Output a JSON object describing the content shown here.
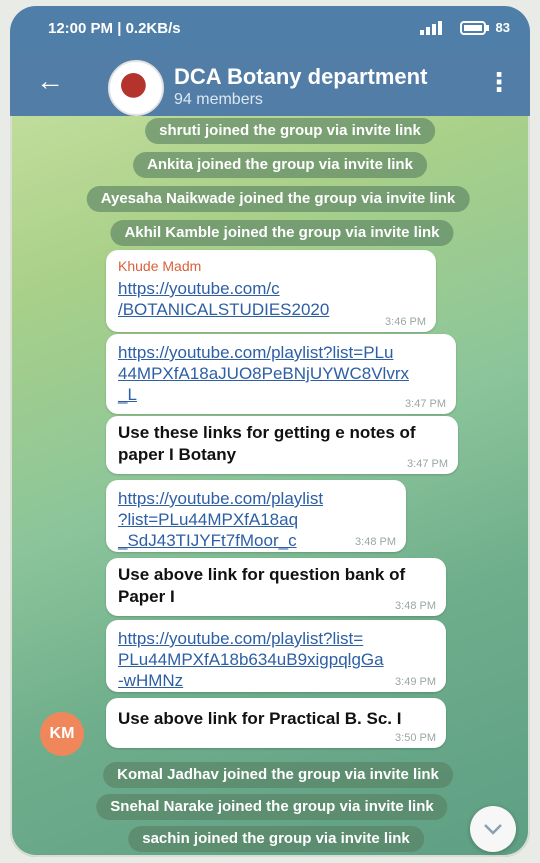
{
  "status": {
    "time": "12:00 PM | 0.2KB/s",
    "battery": "83"
  },
  "header": {
    "back_icon": "arrow-left-icon",
    "title": "DCA Botany department",
    "subtitle": "94 members",
    "menu_icon": "more-vertical-icon"
  },
  "service_top": [
    "shruti joined the group via invite link",
    "Ankita joined the group via invite link",
    "Ayesaha Naikwade joined the group via invite link",
    "Akhil Kamble joined the group via invite link"
  ],
  "messages": [
    {
      "sender": "Khude Madm",
      "lines": [
        "https://youtube.com/c",
        "/BOTANICALSTUDIES2020"
      ],
      "time": "3:46 PM",
      "kind": "link"
    },
    {
      "lines": [
        "https://youtube.com/playlist?list=PLu",
        "44MPXfA18aJUO8PeBNjUYWC8Vlvrx",
        "_L"
      ],
      "time": "3:47 PM",
      "kind": "link"
    },
    {
      "lines": [
        "Use these links for getting e notes of",
        "paper I Botany"
      ],
      "time": "3:47 PM",
      "kind": "text"
    },
    {
      "lines": [
        "https://youtube.com/playlist",
        "?list=PLu44MPXfA18aq",
        "_SdJ43TIJYFt7fMoor_c"
      ],
      "time": "3:48 PM",
      "kind": "link"
    },
    {
      "lines": [
        "Use above link for question bank of",
        "Paper I"
      ],
      "time": "3:48 PM",
      "kind": "text"
    },
    {
      "lines": [
        "https://youtube.com/playlist?list=",
        "PLu44MPXfA18b634uB9xigpqlgGa",
        "-wHMNz"
      ],
      "time": "3:49 PM",
      "kind": "link"
    },
    {
      "lines": [
        "Use above link for Practical B. Sc. I"
      ],
      "time": "3:50 PM",
      "kind": "text"
    }
  ],
  "avatar_initials": "KM",
  "service_bottom": [
    "Komal Jadhav joined the group via invite link",
    "Snehal Narake joined the group via invite link",
    "sachin joined the group via invite link"
  ],
  "scroll_icon": "chevron-down-icon"
}
